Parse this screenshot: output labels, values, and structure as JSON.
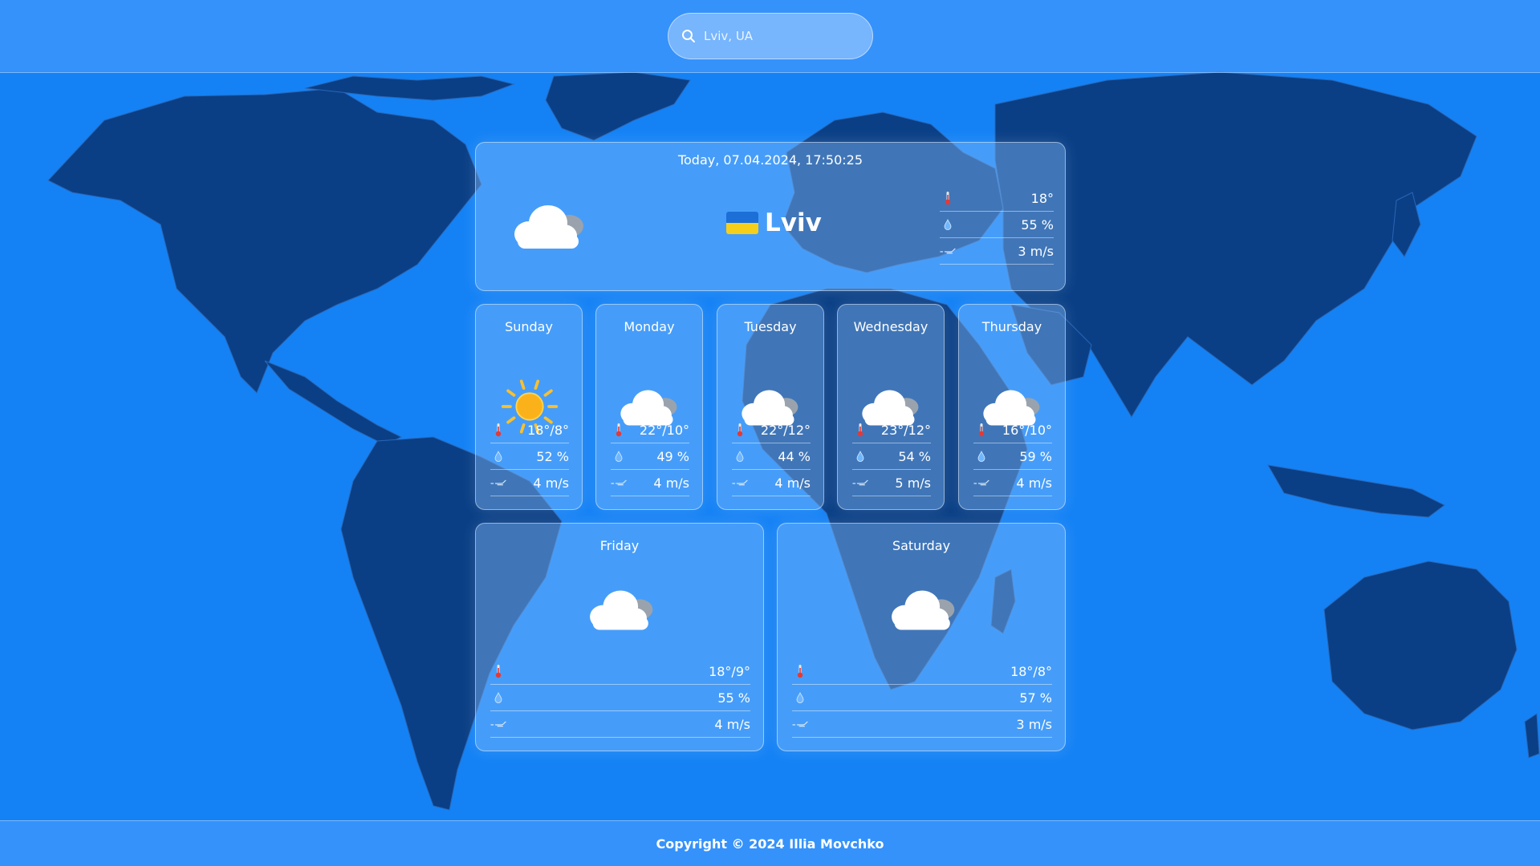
{
  "search": {
    "value": "",
    "placeholder": "Lviv, UA"
  },
  "today": {
    "datetime": "Today, 07.04.2024, 17:50:25",
    "city": "Lviv",
    "icon": "cloud-icon",
    "temp": "18°",
    "humidity": "55 %",
    "wind": "3 m/s"
  },
  "forecast": [
    {
      "day": "Sunday",
      "icon": "sun-icon",
      "temp": "18°/8°",
      "humidity": "52 %",
      "wind": "4 m/s"
    },
    {
      "day": "Monday",
      "icon": "cloud-icon",
      "temp": "22°/10°",
      "humidity": "49 %",
      "wind": "4 m/s"
    },
    {
      "day": "Tuesday",
      "icon": "cloud-icon",
      "temp": "22°/12°",
      "humidity": "44 %",
      "wind": "4 m/s"
    },
    {
      "day": "Wednesday",
      "icon": "cloud-icon",
      "temp": "23°/12°",
      "humidity": "54 %",
      "wind": "5 m/s"
    },
    {
      "day": "Thursday",
      "icon": "cloud-icon",
      "temp": "16°/10°",
      "humidity": "59 %",
      "wind": "4 m/s"
    },
    {
      "day": "Friday",
      "icon": "cloud-icon",
      "temp": "18°/9°",
      "humidity": "55 %",
      "wind": "4 m/s"
    },
    {
      "day": "Saturday",
      "icon": "cloud-icon",
      "temp": "18°/8°",
      "humidity": "57 %",
      "wind": "3 m/s"
    }
  ],
  "footer": {
    "text": "Copyright © 2024 Illia Movchko"
  },
  "colors": {
    "background": "#1482f5",
    "land": "#0a3f86",
    "flag_blue": "#1b6fd6",
    "flag_yellow": "#f6cf1a"
  }
}
